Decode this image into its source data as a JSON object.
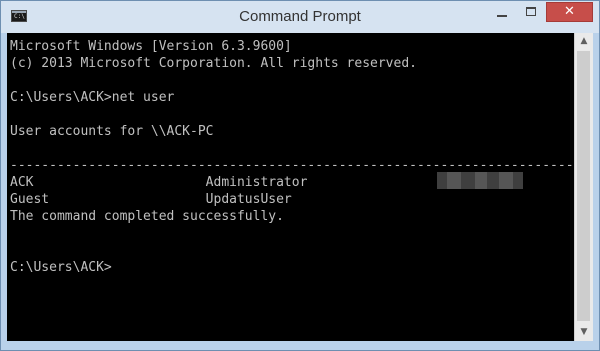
{
  "window": {
    "title": "Command Prompt",
    "icon": "console-icon",
    "icon_glyph": "C:\\",
    "close_glyph": "✕"
  },
  "console": {
    "lines": [
      "Microsoft Windows [Version 6.3.9600]",
      "(c) 2013 Microsoft Corporation. All rights reserved.",
      "",
      "C:\\Users\\ACK>net user",
      "",
      "User accounts for \\\\ACK-PC",
      "",
      "-------------------------------------------------------------------------------",
      "ACK                      Administrator",
      "Guest                    UpdatusUser",
      "The command completed successfully.",
      "",
      "",
      "C:\\Users\\ACK>"
    ]
  },
  "scrollbar": {
    "up_glyph": "▲",
    "down_glyph": "▼"
  },
  "colors": {
    "console_bg": "#000000",
    "console_text": "#c0c0c0",
    "close_button": "#c74e4a",
    "frame": "#b9d1ea"
  }
}
